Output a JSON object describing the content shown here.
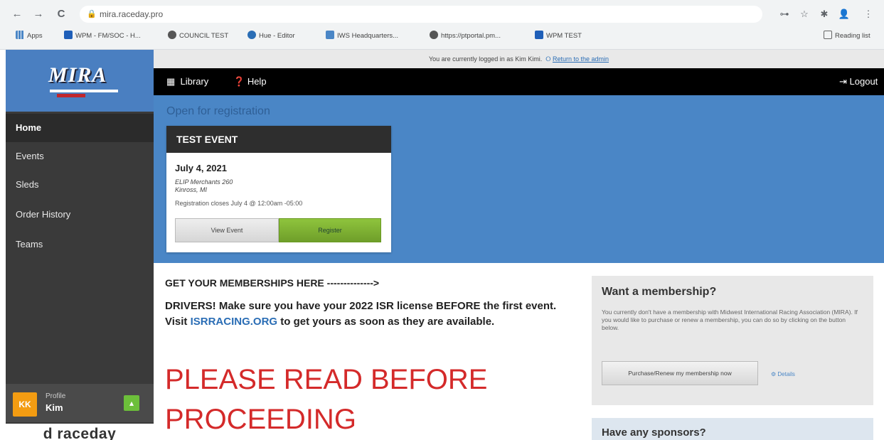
{
  "browser": {
    "url": "mira.raceday.pro",
    "nav_back": "←",
    "nav_forward": "→",
    "nav_reload": "C",
    "lock_icon": "🔒",
    "ext_icons": [
      "⊶",
      "☆",
      "✱",
      "👤",
      "⋮"
    ],
    "bookmarks": [
      {
        "label": "Apps",
        "icon": "apps-grid-icon"
      },
      {
        "label": "WPM - FM/SOC - H...",
        "icon": "wpm-icon"
      },
      {
        "label": "COUNCIL TEST",
        "icon": "globe-icon"
      },
      {
        "label": "Hue - Editor",
        "icon": "hue-icon"
      },
      {
        "label": "IWS Headquarters...",
        "icon": "iws-icon"
      },
      {
        "label": "https://ptportal.pm...",
        "icon": "globe-icon"
      },
      {
        "label": "WPM TEST",
        "icon": "wpm-icon"
      }
    ],
    "reading_list": "Reading list"
  },
  "sidebar": {
    "logo": "MIRA",
    "items": [
      {
        "label": "Home",
        "active": true
      },
      {
        "label": "Events"
      },
      {
        "label": "Sleds"
      },
      {
        "label": "Order History"
      },
      {
        "label": "Teams"
      }
    ],
    "profile": {
      "initials": "KK",
      "label": "Profile",
      "name": "Kim"
    },
    "footer_logo": "d raceday"
  },
  "impersonate": {
    "text": "You are currently logged in as Kim Kimi.",
    "link": "Return to the admin"
  },
  "topnav": {
    "library": "Library",
    "help": "Help",
    "logout": "Logout"
  },
  "banner": {
    "heading": "Open for registration",
    "event": {
      "title": "TEST EVENT",
      "date": "July 4, 2021",
      "venue": "ELIP Merchants 260",
      "city": "Kinross, MI",
      "closes": "Registration closes July 4 @ 12:00am -05:00",
      "view_label": "View Event",
      "register_label": "Register"
    }
  },
  "content": {
    "memberships": "GET YOUR MEMBERSHIPS HERE -------------->",
    "drivers_pre": "DRIVERS! Make sure you have your 2022 ISR license BEFORE the first event. Visit ",
    "drivers_link": "ISRRACING.ORG",
    "drivers_post": " to get yours as soon as they are available.",
    "please_read": "PLEASE READ BEFORE PROCEEDING"
  },
  "membership_box": {
    "title": "Want a membership?",
    "description": "You currently don't have a membership with Midwest International Racing Association (MIRA). If you would like to purchase or renew a membership, you can do so by clicking on the button below.",
    "button": "Purchase/Renew my membership now",
    "details": "Details"
  },
  "sponsor_box": {
    "title": "Have any sponsors?"
  },
  "colors": {
    "banner": "#4a86c6",
    "sidebar": "#3a3a3a",
    "register": "#7fb233",
    "alert_red": "#d42a2a"
  }
}
